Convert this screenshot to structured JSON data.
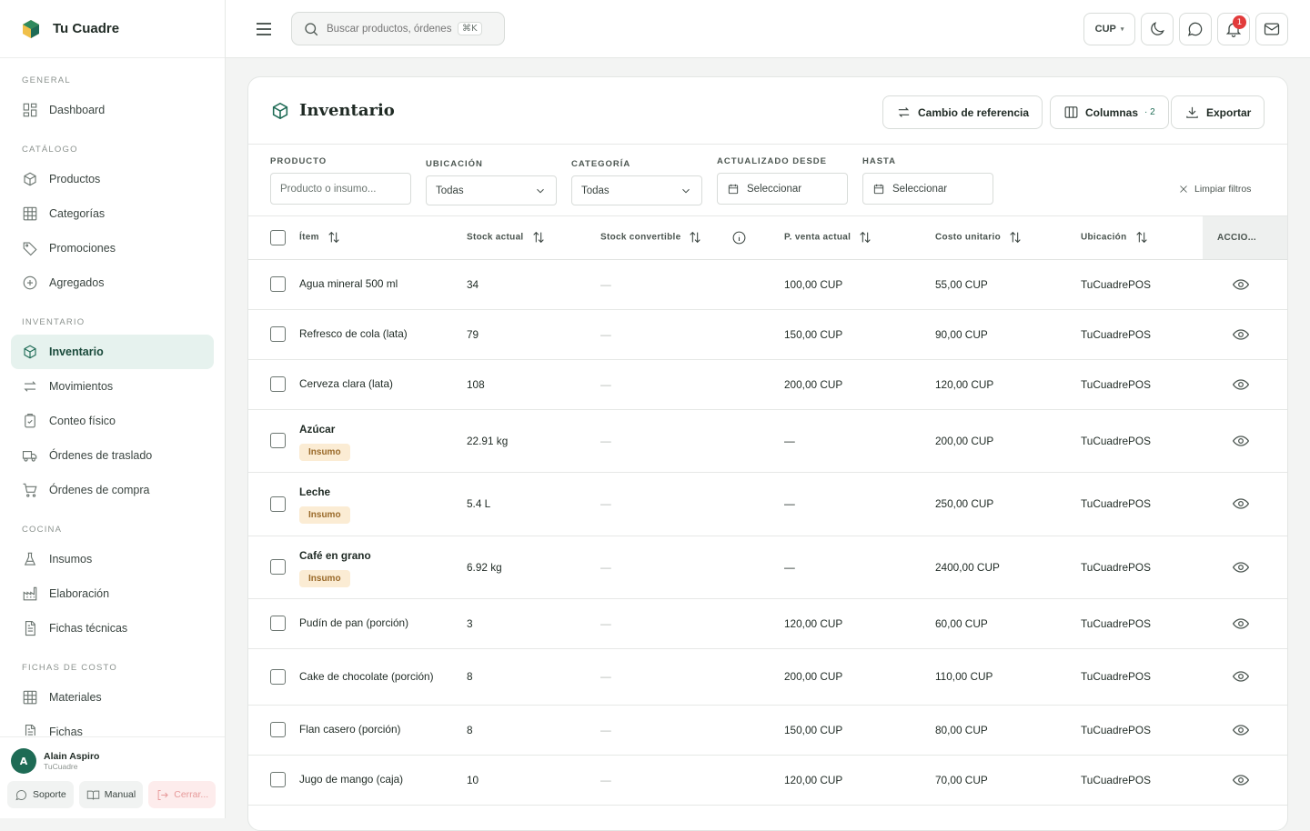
{
  "app": {
    "name": "Tu Cuadre"
  },
  "sidebar": {
    "sections": [
      {
        "title": "GENERAL",
        "items": [
          {
            "label": "Dashboard",
            "icon": "grid-icon"
          }
        ]
      },
      {
        "title": "CATÁLOGO",
        "items": [
          {
            "label": "Productos",
            "icon": "box-icon"
          },
          {
            "label": "Categorías",
            "icon": "table-icon"
          },
          {
            "label": "Promociones",
            "icon": "tag-icon"
          },
          {
            "label": "Agregados",
            "icon": "plus-circle-icon"
          }
        ]
      },
      {
        "title": "INVENTARIO",
        "items": [
          {
            "label": "Inventario",
            "icon": "box-icon",
            "active": true
          },
          {
            "label": "Movimientos",
            "icon": "arrows-icon"
          },
          {
            "label": "Conteo físico",
            "icon": "clipboard-icon"
          },
          {
            "label": "Órdenes de traslado",
            "icon": "truck-icon"
          },
          {
            "label": "Órdenes de compra",
            "icon": "cart-icon"
          }
        ]
      },
      {
        "title": "COCINA",
        "items": [
          {
            "label": "Insumos",
            "icon": "flask-icon"
          },
          {
            "label": "Elaboración",
            "icon": "factory-icon"
          },
          {
            "label": "Fichas técnicas",
            "icon": "document-icon"
          }
        ]
      },
      {
        "title": "FICHAS DE COSTO",
        "items": [
          {
            "label": "Materiales",
            "icon": "table-icon"
          },
          {
            "label": "Fichas",
            "icon": "document-icon"
          }
        ]
      }
    ]
  },
  "user": {
    "initial": "A",
    "name": "Alain Aspiro",
    "org": "TuCuadre"
  },
  "footer": {
    "support": "Soporte",
    "manual": "Manual",
    "logout": "Cerrar..."
  },
  "topbar": {
    "search_placeholder": "Buscar productos, órdenes",
    "shortcut": "⌘K",
    "currency": "CUP",
    "notifications": "1"
  },
  "page": {
    "title": "Inventario",
    "buttons": {
      "reference": "Cambio de referencia",
      "columns": "Columnas",
      "columns_count": "· 2",
      "export": "Exportar"
    }
  },
  "filters": {
    "product_label": "PRODUCTO",
    "product_placeholder": "Producto o insumo...",
    "location_label": "UBICACIÓN",
    "location_value": "Todas",
    "category_label": "CATEGORÍA",
    "category_value": "Todas",
    "from_label": "ACTUALIZADO DESDE",
    "from_value": "Seleccionar",
    "to_label": "HASTA",
    "to_value": "Seleccionar",
    "clear": "Limpiar filtros"
  },
  "table": {
    "headers": {
      "item": "Ítem",
      "stock": "Stock actual",
      "convertible": "Stock convertible",
      "price": "P. venta actual",
      "cost": "Costo unitario",
      "location": "Ubicación",
      "actions": "ACCIO..."
    },
    "rows": [
      {
        "item": "Agua mineral 500 ml",
        "tag": "",
        "stock": "34",
        "convertible": "—",
        "price": "100,00 CUP",
        "cost": "55,00 CUP",
        "location": "TuCuadrePOS"
      },
      {
        "item": "Refresco de cola (lata)",
        "tag": "",
        "stock": "79",
        "convertible": "—",
        "price": "150,00 CUP",
        "cost": "90,00 CUP",
        "location": "TuCuadrePOS"
      },
      {
        "item": "Cerveza clara (lata)",
        "tag": "",
        "stock": "108",
        "convertible": "—",
        "price": "200,00 CUP",
        "cost": "120,00 CUP",
        "location": "TuCuadrePOS"
      },
      {
        "item": "Azúcar",
        "tag": "Insumo",
        "stock": "22.91 kg",
        "convertible": "—",
        "price": "—",
        "cost": "200,00 CUP",
        "location": "TuCuadrePOS"
      },
      {
        "item": "Leche",
        "tag": "Insumo",
        "stock": "5.4 L",
        "convertible": "—",
        "price": "—",
        "cost": "250,00 CUP",
        "location": "TuCuadrePOS"
      },
      {
        "item": "Café en grano",
        "tag": "Insumo",
        "stock": "6.92 kg",
        "convertible": "—",
        "price": "—",
        "cost": "2400,00 CUP",
        "location": "TuCuadrePOS"
      },
      {
        "item": "Pudín de pan (porción)",
        "tag": "",
        "stock": "3",
        "convertible": "—",
        "price": "120,00 CUP",
        "cost": "60,00 CUP",
        "location": "TuCuadrePOS"
      },
      {
        "item": "Cake de chocolate (porción)",
        "tag": "",
        "stock": "8",
        "convertible": "—",
        "price": "200,00 CUP",
        "cost": "110,00 CUP",
        "location": "TuCuadrePOS"
      },
      {
        "item": "Flan casero (porción)",
        "tag": "",
        "stock": "8",
        "convertible": "—",
        "price": "150,00 CUP",
        "cost": "80,00 CUP",
        "location": "TuCuadrePOS"
      },
      {
        "item": "Jugo de mango (caja)",
        "tag": "",
        "stock": "10",
        "convertible": "—",
        "price": "120,00 CUP",
        "cost": "70,00 CUP",
        "location": "TuCuadrePOS"
      }
    ]
  }
}
